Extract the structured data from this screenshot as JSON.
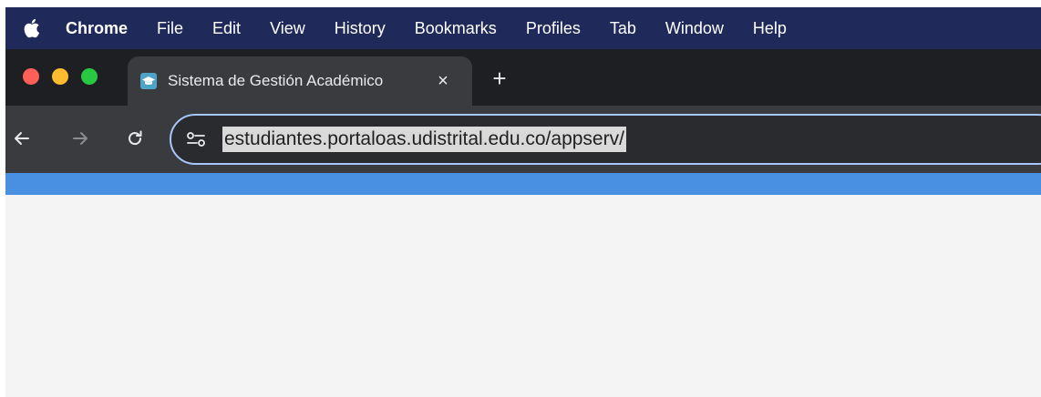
{
  "menubar": {
    "app_name": "Chrome",
    "items": [
      "File",
      "Edit",
      "View",
      "History",
      "Bookmarks",
      "Profiles",
      "Tab",
      "Window",
      "Help"
    ]
  },
  "tab": {
    "title": "Sistema de Gestión Académico",
    "close_label": "×",
    "favicon": "graduation-cap-icon"
  },
  "new_tab_label": "+",
  "toolbar": {
    "url": "estudiantes.portaloas.udistrital.edu.co/appserv/"
  },
  "colors": {
    "menubar_bg": "#1f2a5a",
    "tab_strip_bg": "#1e1f22",
    "toolbar_bg": "#3a3b3e",
    "accent_strip": "#4a90e2",
    "page_bg": "#f4f4f4"
  }
}
